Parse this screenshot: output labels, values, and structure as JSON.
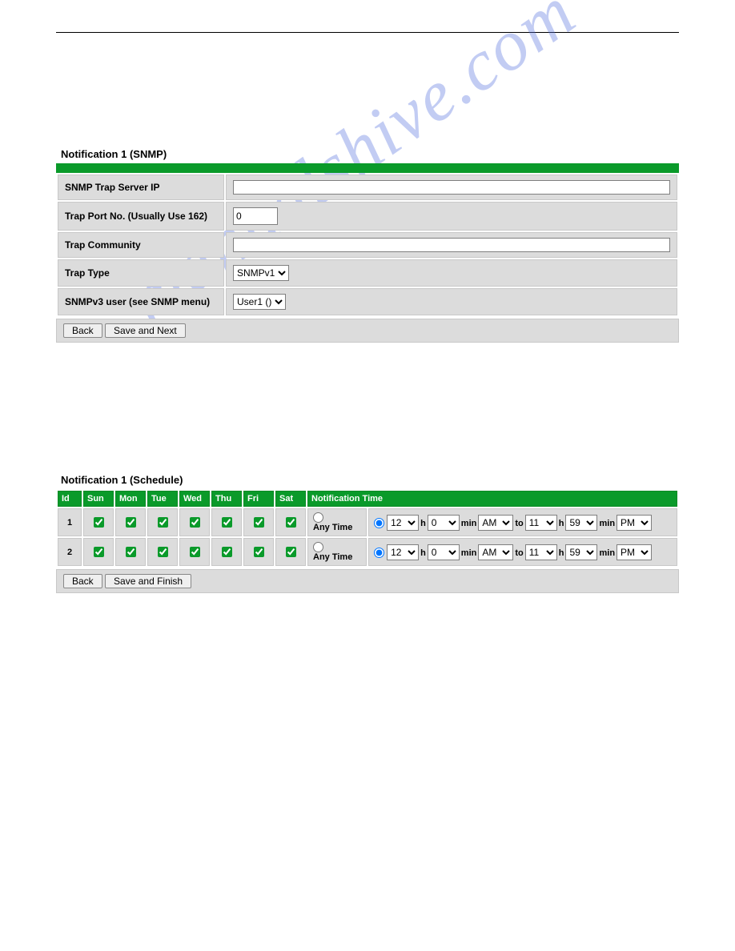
{
  "watermark": "manualshive.com",
  "snmp": {
    "title": "Notification 1 (SNMP)",
    "fields": {
      "trap_server_ip_label": "SNMP Trap Server IP",
      "trap_server_ip_value": "",
      "trap_port_label": "Trap Port No. (Usually Use 162)",
      "trap_port_value": "0",
      "trap_community_label": "Trap Community",
      "trap_community_value": "",
      "trap_type_label": "Trap Type",
      "trap_type_value": "SNMPv1",
      "snmpv3_user_label": "SNMPv3 user (see SNMP menu)",
      "snmpv3_user_value": "User1 ()"
    },
    "buttons": {
      "back": "Back",
      "save_next": "Save and Next"
    }
  },
  "schedule": {
    "title": "Notification 1 (Schedule)",
    "headers": {
      "id": "Id",
      "sun": "Sun",
      "mon": "Mon",
      "tue": "Tue",
      "wed": "Wed",
      "thu": "Thu",
      "fri": "Fri",
      "sat": "Sat",
      "notif_time": "Notification Time"
    },
    "any_time_label": "Any Time",
    "rows": [
      {
        "id": "1",
        "days": [
          true,
          true,
          true,
          true,
          true,
          true,
          true
        ],
        "any_time_selected": false,
        "range_selected": true,
        "from_h": "12",
        "from_m": "0",
        "from_ampm": "AM",
        "to_h": "11",
        "to_m": "59",
        "to_ampm": "PM"
      },
      {
        "id": "2",
        "days": [
          true,
          true,
          true,
          true,
          true,
          true,
          true
        ],
        "any_time_selected": false,
        "range_selected": true,
        "from_h": "12",
        "from_m": "0",
        "from_ampm": "AM",
        "to_h": "11",
        "to_m": "59",
        "to_ampm": "PM"
      }
    ],
    "labels": {
      "h": "h",
      "min": "min",
      "to": "to"
    },
    "buttons": {
      "back": "Back",
      "save_finish": "Save and Finish"
    }
  }
}
